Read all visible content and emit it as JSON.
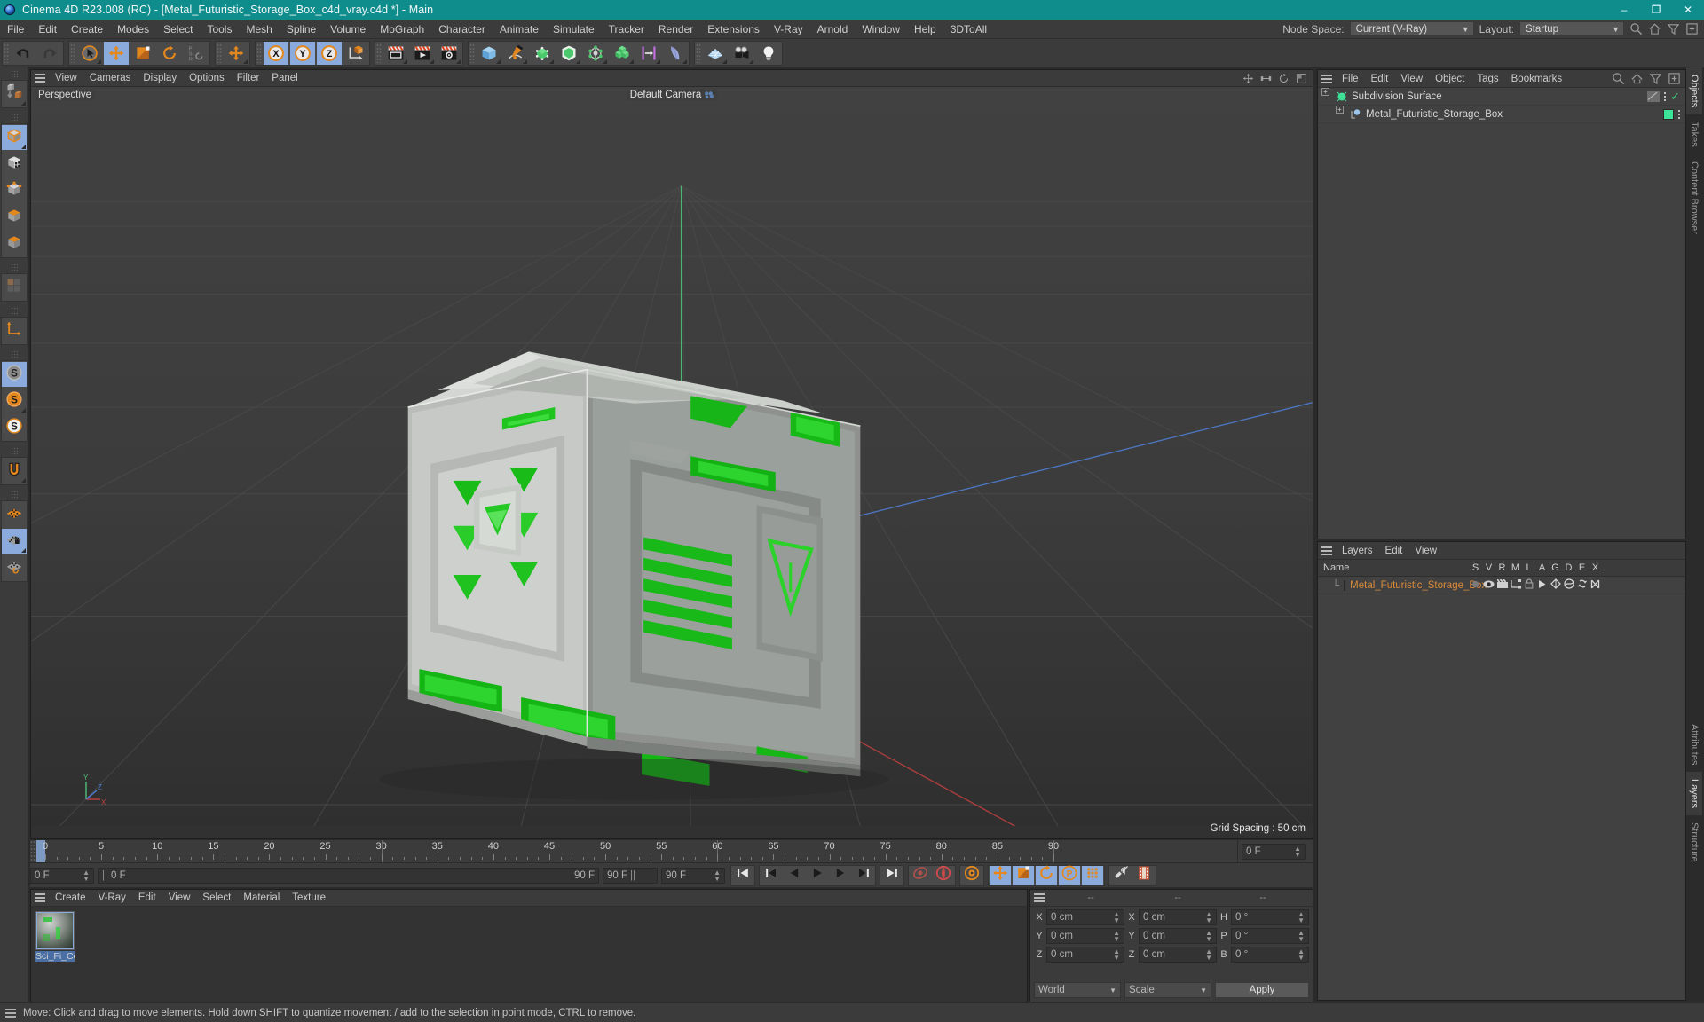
{
  "titlebar": {
    "title": "Cinema 4D R23.008 (RC) - [Metal_Futuristic_Storage_Box_c4d_vray.c4d *] - Main",
    "minimize": "–",
    "maximize": "❐",
    "close": "✕"
  },
  "menubar": {
    "items": [
      "File",
      "Edit",
      "Create",
      "Modes",
      "Select",
      "Tools",
      "Mesh",
      "Spline",
      "Volume",
      "MoGraph",
      "Character",
      "Animate",
      "Simulate",
      "Tracker",
      "Render",
      "Extensions",
      "V-Ray",
      "Arnold",
      "Window",
      "Help",
      "3DToAll"
    ],
    "node_space_label": "Node Space:",
    "node_space_value": "Current (V-Ray)",
    "layout_label": "Layout:",
    "layout_value": "Startup"
  },
  "toolbar": {
    "groups": [
      {
        "name": "undo-redo",
        "buttons": [
          {
            "name": "undo-button",
            "icon": "undo-icon",
            "active": false,
            "disabled": false,
            "corner": false
          },
          {
            "name": "redo-button",
            "icon": "redo-icon",
            "active": false,
            "disabled": true,
            "corner": false
          }
        ]
      },
      {
        "name": "transform-tools",
        "buttons": [
          {
            "name": "live-selection-tool",
            "icon": "cursor-circle-icon",
            "active": false,
            "disabled": false,
            "corner": true
          },
          {
            "name": "move-tool",
            "icon": "move-arrows-icon",
            "active": true,
            "disabled": false,
            "corner": false
          },
          {
            "name": "scale-tool",
            "icon": "scale-box-icon",
            "active": false,
            "disabled": false,
            "corner": false
          },
          {
            "name": "rotate-tool",
            "icon": "rotate-arrow-icon",
            "active": false,
            "disabled": false,
            "corner": false
          },
          {
            "name": "psr-tool",
            "icon": "psr-icon",
            "active": false,
            "disabled": false,
            "corner": false
          }
        ]
      },
      {
        "name": "world-axis",
        "buttons": [
          {
            "name": "world-object-axis-button",
            "icon": "move-arrows-icon",
            "active": false,
            "disabled": false,
            "corner": true
          }
        ]
      },
      {
        "name": "axis-locks",
        "buttons": [
          {
            "name": "lock-x-axis-button",
            "icon": "axis-x-icon",
            "active": true,
            "disabled": false,
            "corner": false
          },
          {
            "name": "lock-y-axis-button",
            "icon": "axis-y-icon",
            "active": true,
            "disabled": false,
            "corner": false
          },
          {
            "name": "lock-z-axis-button",
            "icon": "axis-z-icon",
            "active": true,
            "disabled": false,
            "corner": false
          },
          {
            "name": "object-world-coordinate-button",
            "icon": "coord-cube-icon",
            "active": false,
            "disabled": false,
            "corner": false
          }
        ]
      },
      {
        "name": "render-tools",
        "buttons": [
          {
            "name": "render-view-button",
            "icon": "clapper-view-icon",
            "active": false,
            "disabled": false,
            "corner": true
          },
          {
            "name": "render-to-picture-viewer-button",
            "icon": "clapper-play-icon",
            "active": false,
            "disabled": false,
            "corner": true
          },
          {
            "name": "render-settings-button",
            "icon": "clapper-gear-icon",
            "active": false,
            "disabled": false,
            "corner": true
          }
        ]
      },
      {
        "name": "object-tools",
        "buttons": [
          {
            "name": "add-cube-button",
            "icon": "cube-blue-icon",
            "active": false,
            "disabled": false,
            "corner": true
          },
          {
            "name": "add-spline-button",
            "icon": "pen-spline-icon",
            "active": false,
            "disabled": false,
            "corner": true
          },
          {
            "name": "add-nurbs-button",
            "icon": "nurbs-green-icon",
            "active": false,
            "disabled": false,
            "corner": true
          },
          {
            "name": "add-array-button",
            "icon": "array-green-icon",
            "active": false,
            "disabled": false,
            "corner": true
          },
          {
            "name": "add-deformer-button",
            "icon": "deformer-node-icon",
            "active": false,
            "disabled": false,
            "corner": true
          },
          {
            "name": "add-mograph-button",
            "icon": "cloner-cubes-icon",
            "active": false,
            "disabled": false,
            "corner": true
          },
          {
            "name": "add-field-button",
            "icon": "field-bars-icon",
            "active": false,
            "disabled": false,
            "corner": true
          },
          {
            "name": "add-dynamics-button",
            "icon": "cloth-wave-icon",
            "active": false,
            "disabled": false,
            "corner": true
          }
        ]
      },
      {
        "name": "scene-tools",
        "buttons": [
          {
            "name": "add-floor-button",
            "icon": "floor-grid-icon",
            "active": false,
            "disabled": false,
            "corner": true
          },
          {
            "name": "add-camera-button",
            "icon": "camera-icon",
            "active": false,
            "disabled": false,
            "corner": true
          },
          {
            "name": "add-light-button",
            "icon": "light-bulb-icon",
            "active": false,
            "disabled": false,
            "corner": false
          }
        ]
      }
    ]
  },
  "left_palette": {
    "groups": [
      {
        "name": "selection-mode-group",
        "buttons": [
          {
            "name": "make-editable-button",
            "icon": "make-editable-icon",
            "active": false,
            "corner": true
          }
        ]
      },
      {
        "name": "mode-group",
        "buttons": [
          {
            "name": "model-mode-button",
            "icon": "model-cube-icon",
            "active": true,
            "corner": true
          },
          {
            "name": "texture-mode-button",
            "icon": "texture-checker-icon",
            "active": false,
            "corner": false
          },
          {
            "name": "points-mode-button",
            "icon": "points-cube-icon",
            "active": false,
            "corner": false
          },
          {
            "name": "edges-mode-button",
            "icon": "edges-cube-icon",
            "active": false,
            "corner": false
          },
          {
            "name": "polygons-mode-button",
            "icon": "polygons-cube-icon",
            "active": false,
            "corner": false
          }
        ]
      },
      {
        "name": "uv-group",
        "buttons": [
          {
            "name": "uv-mode-button",
            "icon": "uv-tiles-icon",
            "active": false,
            "corner": false
          }
        ]
      },
      {
        "name": "axis-group",
        "buttons": [
          {
            "name": "enable-axis-button",
            "icon": "axis-L-icon",
            "active": false,
            "corner": false
          }
        ]
      },
      {
        "name": "snap-group",
        "buttons": [
          {
            "name": "enable-snap-button",
            "icon": "snap-S-grey-icon",
            "active": true,
            "corner": false
          },
          {
            "name": "quantize-button",
            "icon": "snap-S-orange-icon",
            "active": false,
            "corner": true
          },
          {
            "name": "workplane-snap-button",
            "icon": "snap-S-white-icon",
            "active": false,
            "corner": false
          }
        ]
      },
      {
        "name": "magnet-group",
        "buttons": [
          {
            "name": "magnet-tool-button",
            "icon": "magnet-icon",
            "active": false,
            "corner": true
          }
        ]
      },
      {
        "name": "workplane-group",
        "buttons": [
          {
            "name": "workplane-button",
            "icon": "workplane-orange-icon",
            "active": false,
            "corner": false
          },
          {
            "name": "lock-workplane-button",
            "icon": "workplane-lock-icon",
            "active": true,
            "corner": true
          },
          {
            "name": "planar-workplane-button",
            "icon": "workplane-rotate-icon",
            "active": false,
            "corner": false
          }
        ]
      }
    ]
  },
  "viewport": {
    "menu": [
      "View",
      "Cameras",
      "Display",
      "Options",
      "Filter",
      "Panel"
    ],
    "label": "Perspective",
    "camera_label": "Default Camera",
    "grid_spacing": "Grid Spacing : 50 cm",
    "axis_gizmo": {
      "x": "X",
      "y": "Y",
      "z": "Z"
    }
  },
  "timeline": {
    "ticks": [
      0,
      5,
      10,
      15,
      20,
      25,
      30,
      35,
      40,
      45,
      50,
      55,
      60,
      65,
      70,
      75,
      80,
      85,
      90
    ],
    "current_frame": "0 F",
    "start_frame": "0 F",
    "end_frame": "90 F",
    "preview_min": "0 F",
    "preview_max": "90 F",
    "right_frame": "0 F"
  },
  "transport": {
    "buttons": [
      {
        "name": "go-to-start-button",
        "icon": "skip-start-icon",
        "active": false,
        "corner": false
      },
      {
        "name": "go-to-previous-key-button",
        "icon": "prev-key-icon",
        "active": false,
        "corner": false
      },
      {
        "name": "step-back-button",
        "icon": "step-back-icon",
        "active": false,
        "corner": false
      },
      {
        "name": "play-button",
        "icon": "play-icon",
        "active": false,
        "corner": false
      },
      {
        "name": "step-forward-button",
        "icon": "step-forward-icon",
        "active": false,
        "corner": false
      },
      {
        "name": "go-to-next-key-button",
        "icon": "next-key-icon",
        "active": false,
        "corner": false
      },
      {
        "name": "go-to-end-button",
        "icon": "skip-end-icon",
        "active": false,
        "corner": false
      },
      {
        "name": "record-active-objects-button",
        "icon": "record-key-icon",
        "active": false,
        "corner": false
      },
      {
        "name": "autokeying-button",
        "icon": "autokey-icon",
        "active": false,
        "corner": false
      },
      {
        "name": "keyframe-selection-button",
        "icon": "key-gear-icon",
        "active": false,
        "corner": false
      },
      {
        "name": "position-key-button",
        "icon": "pos-key-icon",
        "active": true,
        "corner": false
      },
      {
        "name": "scale-key-button",
        "icon": "scale-key-icon",
        "active": true,
        "corner": false
      },
      {
        "name": "rotation-key-button",
        "icon": "rot-key-icon",
        "active": true,
        "corner": false
      },
      {
        "name": "parameter-key-button",
        "icon": "param-key-icon",
        "active": true,
        "corner": false
      },
      {
        "name": "point-level-animation-button",
        "icon": "pla-dots-icon",
        "active": true,
        "corner": false
      },
      {
        "name": "sound-button",
        "icon": "sound-icon",
        "active": false,
        "corner": false
      },
      {
        "name": "timeline-filmstrip-button",
        "icon": "filmstrip-icon",
        "active": false,
        "corner": false
      }
    ]
  },
  "material_manager": {
    "menu": [
      "Create",
      "V-Ray",
      "Edit",
      "View",
      "Select",
      "Material",
      "Texture"
    ],
    "materials": [
      {
        "name": "Sci_Fi_Co"
      }
    ]
  },
  "coordinates": {
    "headers": [
      "--",
      "--",
      "--"
    ],
    "rows": [
      {
        "label1": "X",
        "value1": "0 cm",
        "label2": "X",
        "value2": "0 cm",
        "label3": "H",
        "value3": "0 °"
      },
      {
        "label1": "Y",
        "value1": "0 cm",
        "label2": "Y",
        "value2": "0 cm",
        "label3": "P",
        "value3": "0 °"
      },
      {
        "label1": "Z",
        "value1": "0 cm",
        "label2": "Z",
        "value2": "0 cm",
        "label3": "B",
        "value3": "0 °"
      }
    ],
    "system": "World",
    "mode": "Scale",
    "apply_label": "Apply"
  },
  "object_manager": {
    "menu": [
      "File",
      "Edit",
      "View",
      "Object",
      "Tags",
      "Bookmarks"
    ],
    "rows": [
      {
        "name": "Subdivision Surface",
        "indent": 0,
        "icon": "subdivision-surface-icon",
        "has_checkmark": true,
        "has_tag": true
      },
      {
        "name": "Metal_Futuristic_Storage_Box",
        "indent": 1,
        "icon": "polygon-object-icon",
        "has_checkmark": false,
        "has_tag": true
      }
    ]
  },
  "layer_manager": {
    "menu": [
      "Layers",
      "Edit",
      "View"
    ],
    "columns": [
      "Name",
      "S",
      "V",
      "R",
      "M",
      "L",
      "A",
      "G",
      "D",
      "E",
      "X"
    ],
    "rows": [
      {
        "name": "Metal_Futuristic_Storage_Box",
        "color": "#3ee39a"
      }
    ]
  },
  "right_tabs_top": [
    "Objects",
    "Takes",
    "Content Browser"
  ],
  "right_tabs_bottom": [
    "Attributes",
    "Layers",
    "Structure"
  ],
  "statusbar": {
    "message": "Move: Click and drag to move elements. Hold down SHIFT to quantize movement / add to the selection in point mode, CTRL to remove."
  },
  "colors": {
    "accent_teal": "#0f8c8c",
    "active_blue": "#8aabdb",
    "orange": "#e08020",
    "green": "#3ee39a",
    "layer_text": "#d98a3a"
  }
}
